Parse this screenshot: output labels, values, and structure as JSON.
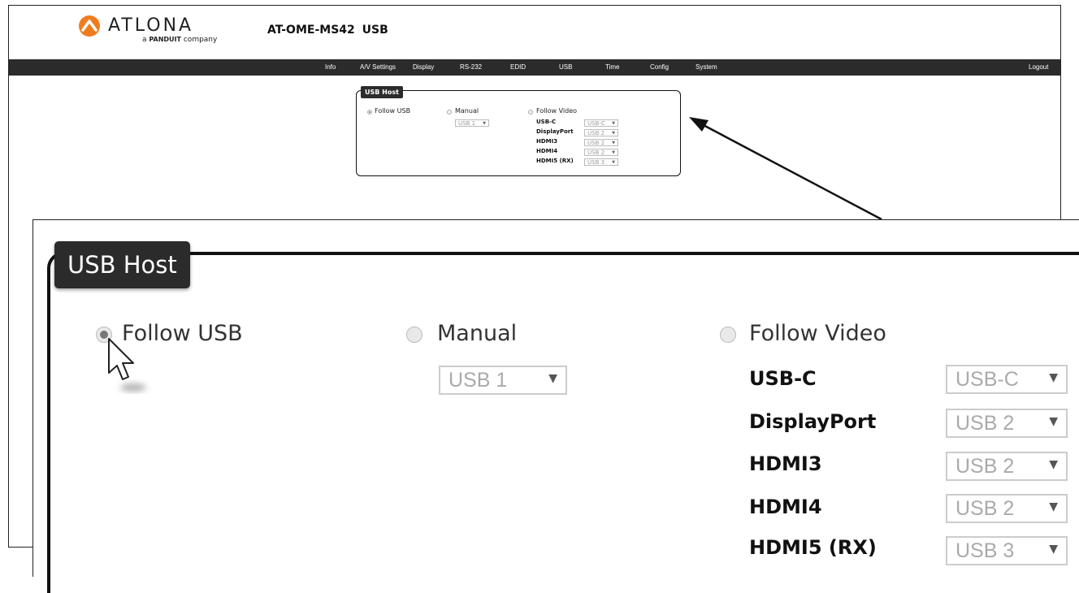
{
  "header": {
    "brand": "ATLONA",
    "brand_sub_prefix": "a",
    "brand_sub_company": "PANDUIT",
    "brand_sub_suffix": "company",
    "page_title": "AT-OME-MS42  USB"
  },
  "nav": {
    "items": [
      "Info",
      "A/V Settings",
      "Display",
      "RS-232",
      "EDID",
      "USB",
      "Time",
      "Config",
      "System"
    ],
    "logout": "Logout"
  },
  "usb_host": {
    "legend": "USB Host",
    "modes": [
      {
        "label": "Follow USB",
        "selected": true
      },
      {
        "label": "Manual",
        "selected": false
      },
      {
        "label": "Follow Video",
        "selected": false
      }
    ],
    "manual_select": "USB 1",
    "video_map": [
      {
        "input": "USB-C",
        "usb": "USB-C"
      },
      {
        "input": "DisplayPort",
        "usb": "USB 2"
      },
      {
        "input": "HDMI3",
        "usb": "USB 2"
      },
      {
        "input": "HDMI4",
        "usb": "USB 2"
      },
      {
        "input": "HDMI5 (RX)",
        "usb": "USB 3"
      }
    ]
  },
  "colors": {
    "accent_logo": "#f07c1e",
    "navbar": "#2b2b2b"
  }
}
